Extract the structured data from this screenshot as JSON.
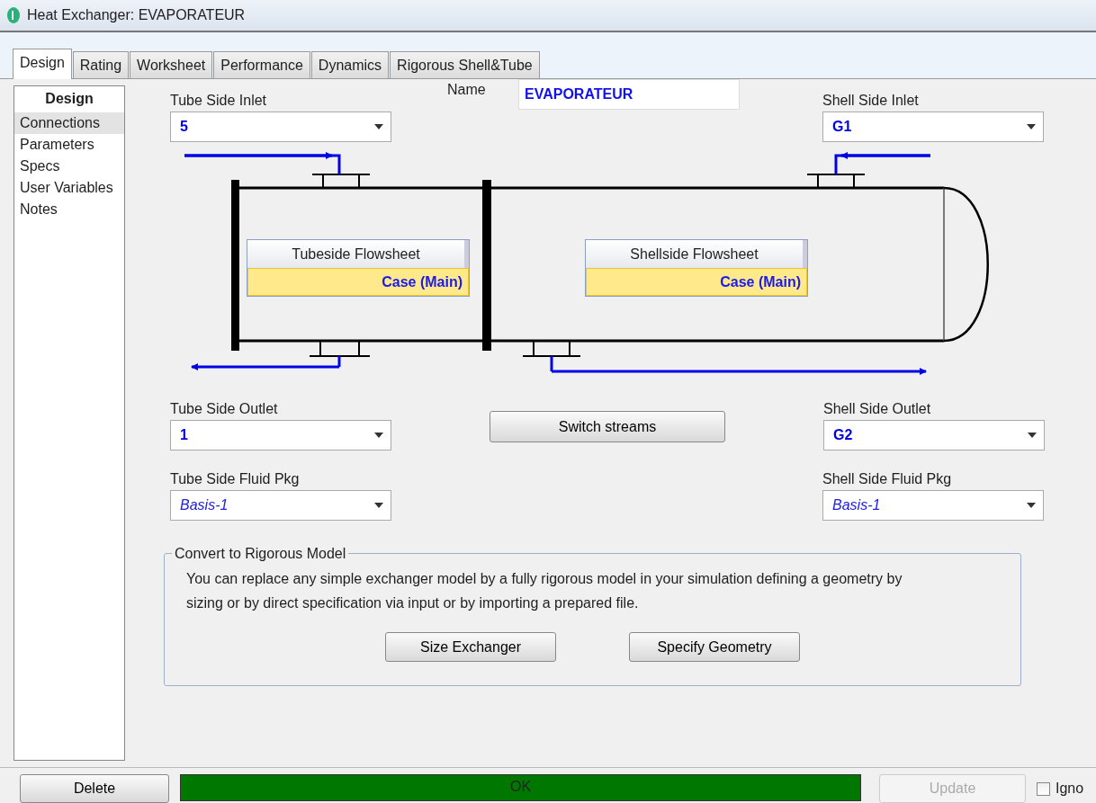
{
  "window": {
    "title": "Heat Exchanger: EVAPORATEUR"
  },
  "tabs": [
    {
      "label": "Design",
      "selected": true
    },
    {
      "label": "Rating",
      "selected": false
    },
    {
      "label": "Worksheet",
      "selected": false
    },
    {
      "label": "Performance",
      "selected": false
    },
    {
      "label": "Dynamics",
      "selected": false
    },
    {
      "label": "Rigorous Shell&Tube",
      "selected": false
    }
  ],
  "sidebar": {
    "header": "Design",
    "items": [
      {
        "label": "Connections",
        "selected": true
      },
      {
        "label": "Parameters",
        "selected": false
      },
      {
        "label": "Specs",
        "selected": false
      },
      {
        "label": "User Variables",
        "selected": false
      },
      {
        "label": "Notes",
        "selected": false
      }
    ]
  },
  "tube_side_inlet": {
    "label": "Tube Side Inlet",
    "value": "5"
  },
  "name": {
    "label": "Name",
    "value": "EVAPORATEUR"
  },
  "shell_side_inlet": {
    "label": "Shell Side Inlet",
    "value": "G1"
  },
  "flowsheets": [
    {
      "title": "Tubeside Flowsheet",
      "case": "Case (Main)"
    },
    {
      "title": "Shellside Flowsheet",
      "case": "Case (Main)"
    }
  ],
  "tube_side_outlet": {
    "label": "Tube Side Outlet",
    "value": "1"
  },
  "switch_button": "Switch streams",
  "shell_side_outlet": {
    "label": "Shell Side Outlet",
    "value": "G2"
  },
  "tube_side_fluid_pkg": {
    "label": "Tube Side Fluid Pkg",
    "value": "Basis-1"
  },
  "shell_side_fluid_pkg": {
    "label": "Shell Side Fluid Pkg",
    "value": "Basis-1"
  },
  "convert": {
    "legend": "Convert to Rigorous Model",
    "text": "You can replace any simple exchanger model by a fully rigorous model in your simulation defining a geometry by sizing or by direct specification via input or by importing a prepared file.",
    "buttons": [
      "Size Exchanger",
      "Specify Geometry"
    ]
  },
  "footer": {
    "delete": "Delete",
    "status": "OK",
    "update": {
      "label": "Update",
      "disabled": true
    },
    "ignore": {
      "label": "Igno",
      "checked": false
    }
  }
}
